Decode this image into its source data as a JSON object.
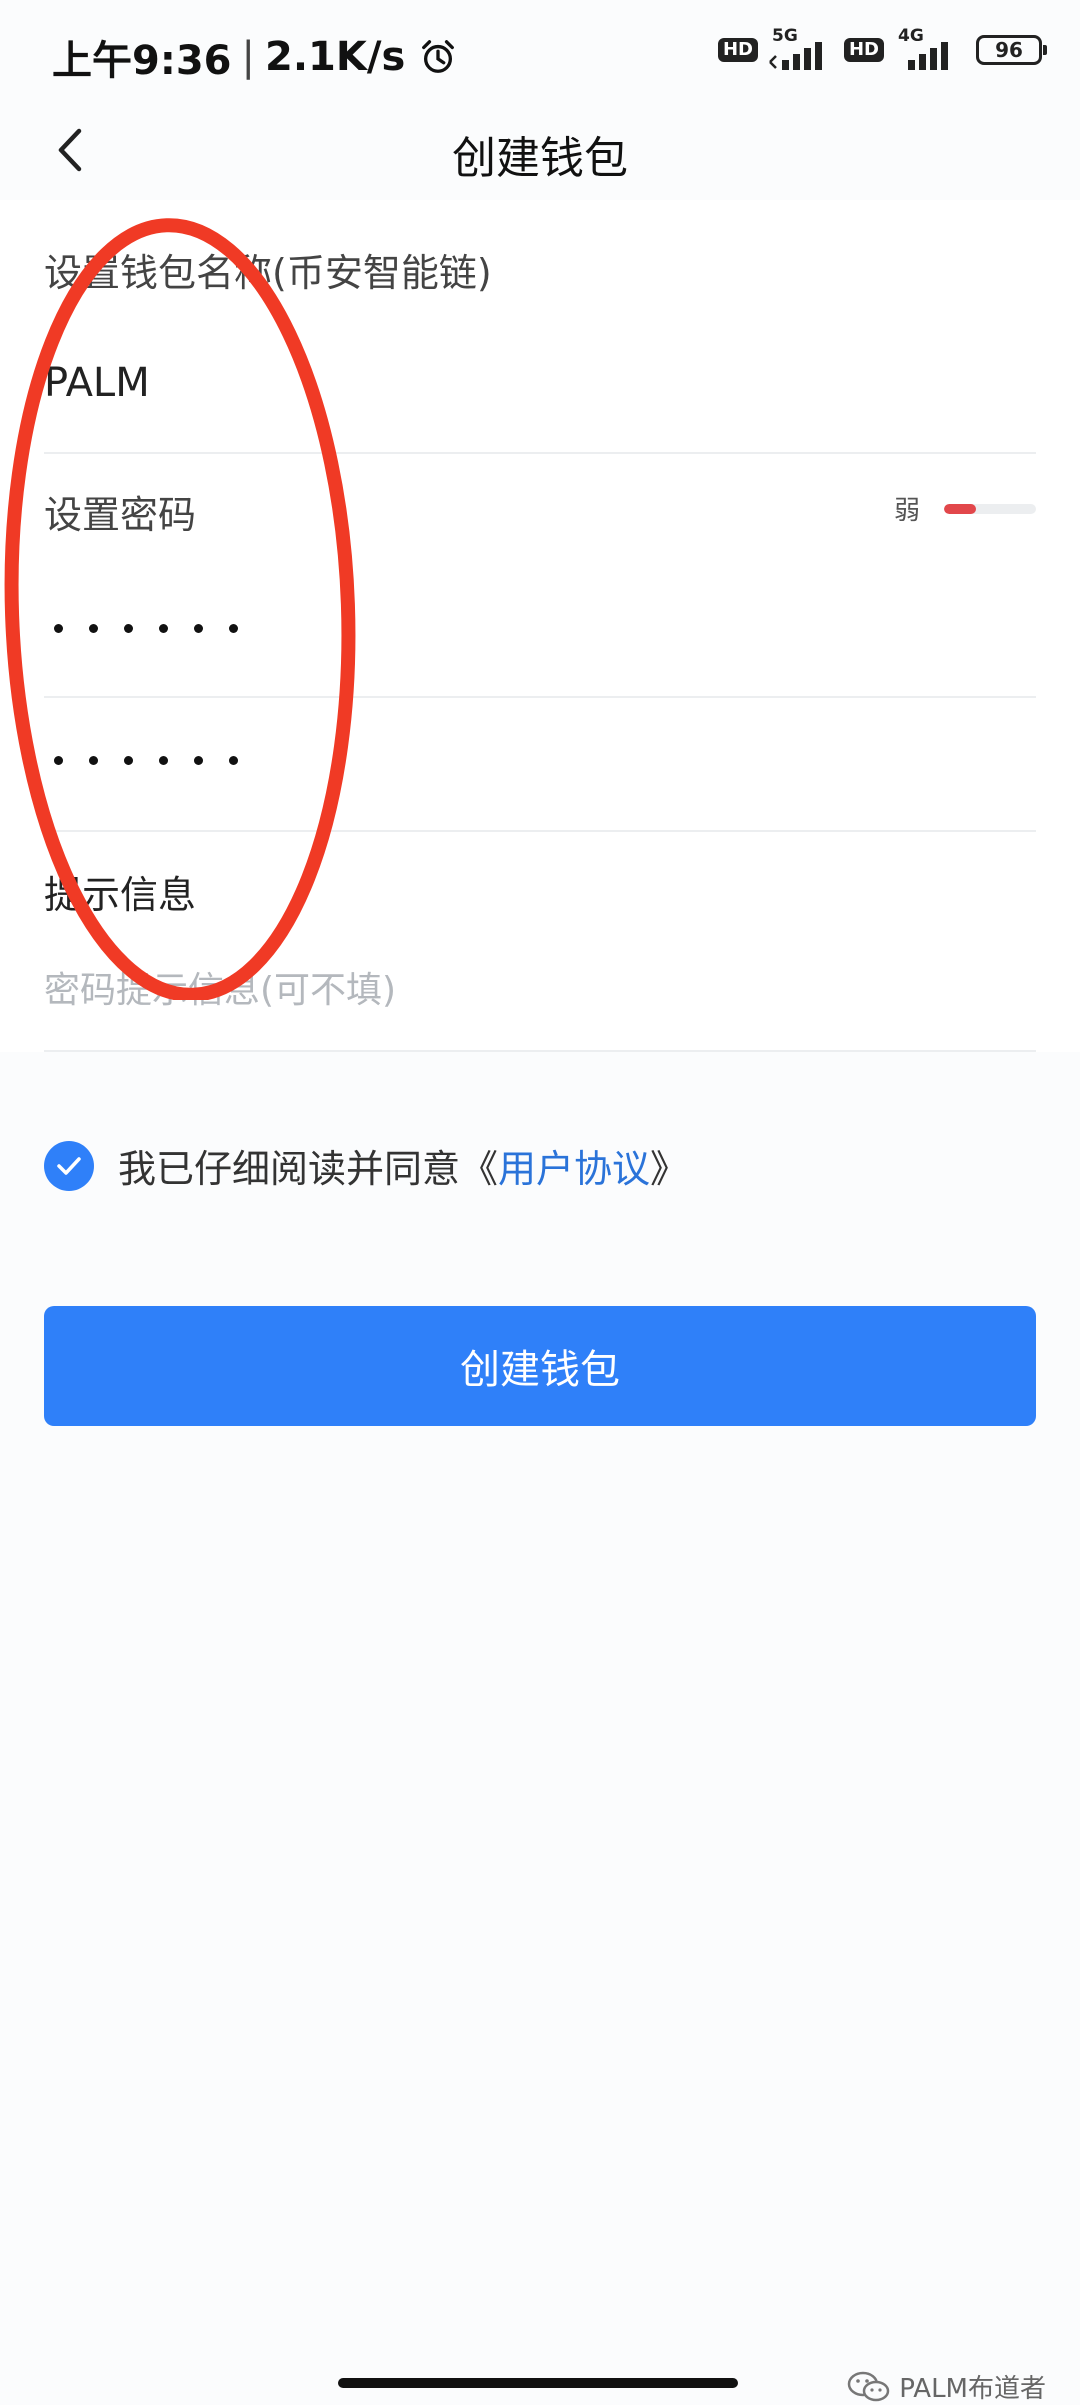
{
  "status_bar": {
    "time": "上午9:36",
    "separator": "|",
    "net_speed": "2.1K/s",
    "hd1": "HD",
    "gen1": "5G",
    "hd2": "HD",
    "gen2": "4G",
    "battery": "96"
  },
  "header": {
    "title": "创建钱包",
    "back_icon": "chevron-left-icon"
  },
  "form": {
    "wallet_name_label": "设置钱包名称(币安智能链)",
    "wallet_name_value": "PALM",
    "password_label": "设置密码",
    "password_strength_label": "弱",
    "password_strength_level": 0.35,
    "password_dot_count": 6,
    "confirm_dot_count": 6,
    "hint_label": "提示信息",
    "hint_placeholder": "密码提示信息(可不填)"
  },
  "agreement": {
    "checked": true,
    "text": "我已仔细阅读并同意",
    "open_quote": "《",
    "link_text": "用户协议",
    "close_quote": "》"
  },
  "create_button": {
    "label": "创建钱包"
  },
  "watermark": {
    "text": "PALM布道者"
  },
  "colors": {
    "accent": "#2f80f9",
    "link": "#2a73d9",
    "strength_weak": "#e2474b",
    "annotation_red": "#f03a25"
  }
}
